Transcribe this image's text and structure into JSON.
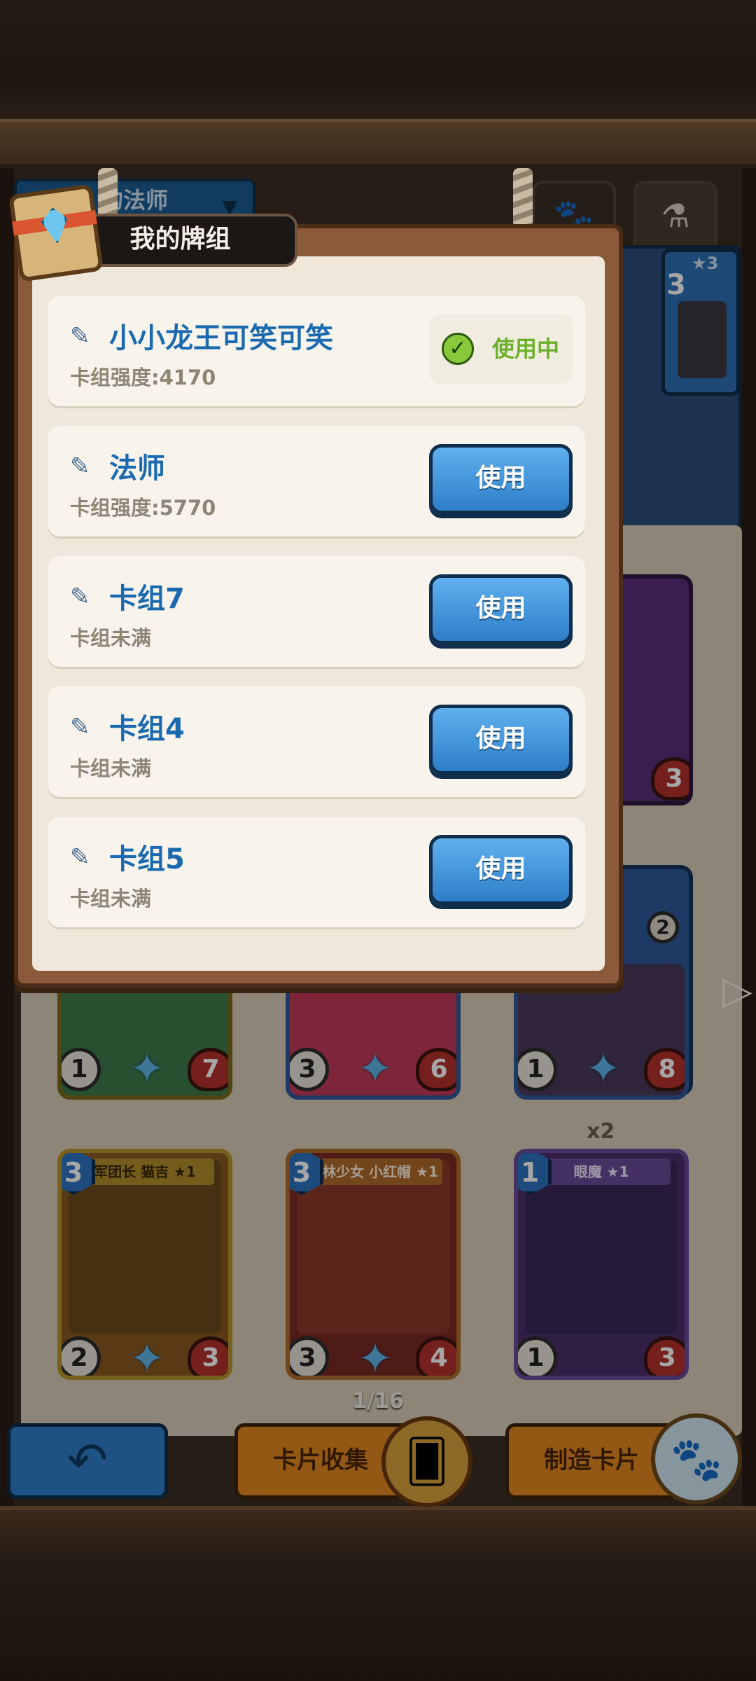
{
  "modal": {
    "title": "我的牌组",
    "decks": [
      {
        "name": "小小龙王可笑可笑",
        "info": "卡组强度:4170",
        "status": "使用中",
        "in_use": true
      },
      {
        "name": "法师",
        "info": "卡组强度:5770",
        "button": "使用",
        "in_use": false
      },
      {
        "name": "卡组7",
        "info": "卡组未满",
        "button": "使用",
        "in_use": false
      },
      {
        "name": "卡组4",
        "info": "卡组未满",
        "button": "使用",
        "in_use": false
      },
      {
        "name": "卡组5",
        "info": "卡组未满",
        "button": "使用",
        "in_use": false
      }
    ]
  },
  "background": {
    "deck_selector": "的法师",
    "cards": [
      {
        "name": "军团长 猫吉 ★1",
        "cost": "3",
        "attack": "2",
        "hp": "3"
      },
      {
        "name": "森林少女 小红帽 ★1",
        "cost": "3",
        "attack": "3",
        "hp": "4"
      },
      {
        "name": "眼魔 ★1",
        "cost": "1",
        "attack": "1",
        "hp": "3"
      }
    ],
    "mid_row_stats": [
      {
        "attack": "1",
        "hp": "7"
      },
      {
        "attack": "3",
        "hp": "6"
      },
      {
        "attack": "1",
        "hp": "8"
      }
    ],
    "top_right_card_level": "★3",
    "top_right_card_cost": "3",
    "peek_hp_1": "3",
    "peek_hp_2": "2",
    "copies": "x2",
    "page": "1/16"
  },
  "bottom_bar": {
    "collection_label": "卡片收集",
    "craft_label": "制造卡片"
  },
  "icons": {
    "edit": "edit-icon",
    "check": "check-icon",
    "back": "back-arrow-icon",
    "paw": "paw-icon",
    "potion": "potion-icon"
  },
  "colors": {
    "deck_name": "#1b6ab0",
    "use_button": "#2e7ec8",
    "in_use_text": "#6bb029",
    "orange_button": "#e2881e"
  }
}
